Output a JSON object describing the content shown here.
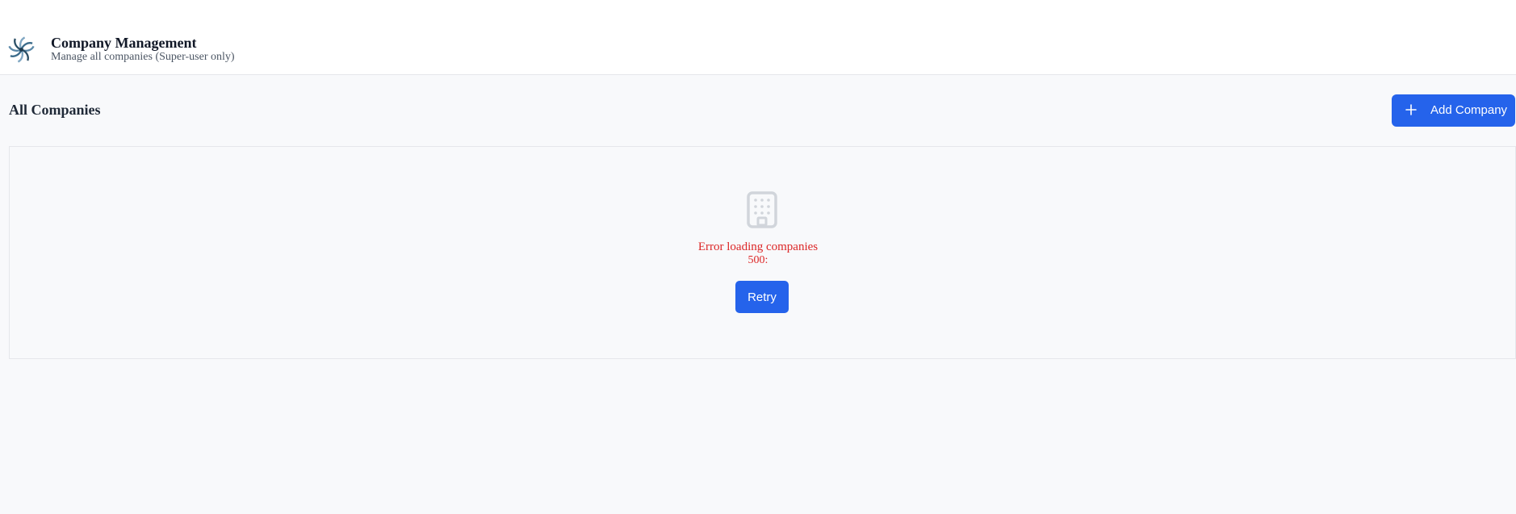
{
  "header": {
    "logo_icon": "pinwheel-logo",
    "title": "Company Management",
    "subtitle": "Manage all companies (Super-user only)"
  },
  "main": {
    "section_title": "All Companies",
    "add_button": {
      "label": "Add Company",
      "icon": "plus-icon"
    },
    "empty_state": {
      "icon": "building-icon",
      "error_title": "Error loading companies",
      "error_code": "500:",
      "retry_label": "Retry"
    }
  },
  "colors": {
    "primary": "#2563eb",
    "error": "#dc2626",
    "background": "#f8f9fb",
    "icon_gray": "#d1d5db"
  }
}
